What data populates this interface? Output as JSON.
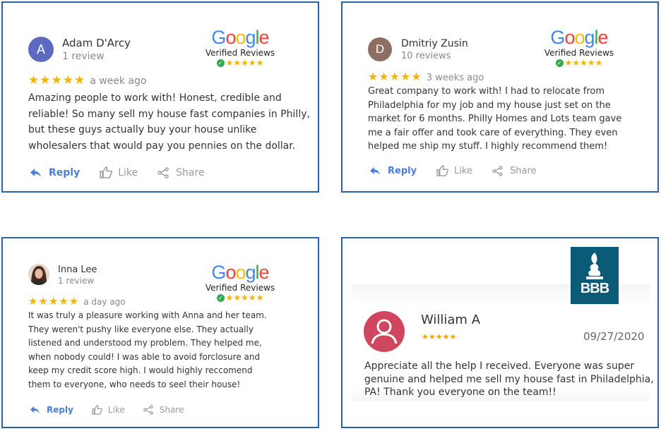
{
  "google_badge": {
    "letters": [
      "G",
      "o",
      "o",
      "g",
      "l",
      "e"
    ],
    "letter_colors": [
      "#4285F4",
      "#EA4335",
      "#FBBC05",
      "#4285F4",
      "#34A853",
      "#EA4335"
    ],
    "verified_label": "Verified Reviews",
    "stars": "★★★★★"
  },
  "reviews": [
    {
      "initial": "A",
      "avatar_color": "#5c6bc0",
      "name": "Adam D'Arcy",
      "count": "1 review",
      "stars": "★★★★★",
      "when": "a week ago",
      "lines": [
        "Amazing people to work with! Honest, credible and",
        "reliable! So many sell my house fast companies in Philly,",
        "but these guys actually buy your house unlike",
        "wholesalers that would pay you pennies on the dollar."
      ],
      "reply": "Reply",
      "like": "Like",
      "share": "Share"
    },
    {
      "initial": "D",
      "avatar_color": "#8d6e63",
      "name": "Dmitriy Zusin",
      "count": "10 reviews",
      "stars": "★★★★★",
      "when": "3 weeks ago",
      "lines": [
        "Great company to work with! I had to relocate from",
        "Philadelphia for my job and my house just set on the",
        "market for 6 months. Philly Homes and Lots team gave",
        "me a fair offer and took care of everything. They even",
        "helped me ship my stuff. I highly recommend them!"
      ],
      "reply": "Reply",
      "like": "Like",
      "share": "Share"
    },
    {
      "name": "Inna Lee",
      "count": "1 review",
      "stars": "★★★★★",
      "when": "a day ago",
      "lines": [
        "It was truly a pleasure working with Anna and her team.",
        "They weren't pushy like everyone else. They actually",
        "listened and understood my problem. They helped me,",
        "when nobody could! I was able to avoid forclosure and",
        "keep my credit score high. I would highly reccomend",
        "them to everyone, who needs to seel their house!"
      ],
      "reply": "Reply",
      "like": "Like",
      "share": "Share"
    }
  ],
  "bbb": {
    "logo_text": "BBB",
    "brand_color": "#0b5a78",
    "name": "William A",
    "stars": "★★★★★",
    "date": "09/27/2020",
    "avatar_color": "#d0465e",
    "lines": [
      "Appreciate all the help I received. Everyone was super",
      "genuine and helped me sell my house fast in Philadelphia,",
      "PA! Thank you everyone on the team!!"
    ]
  }
}
